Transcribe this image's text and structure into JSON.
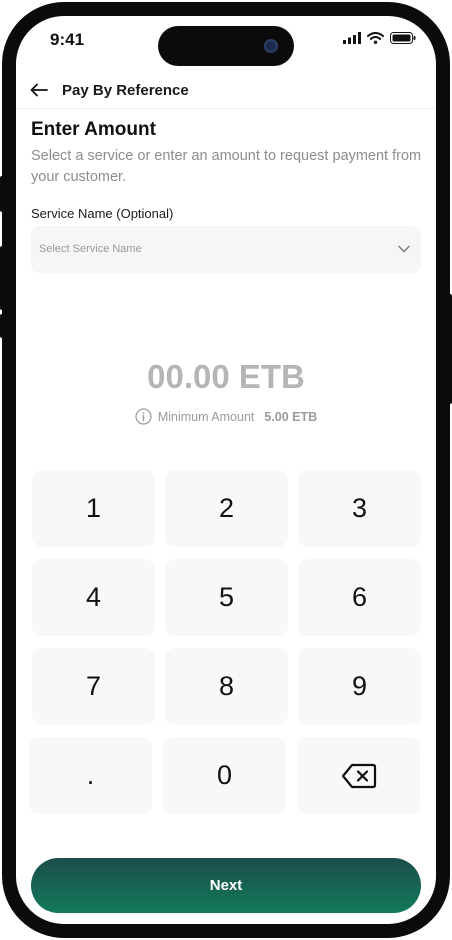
{
  "status_bar": {
    "time": "9:41"
  },
  "nav": {
    "title": "Pay By Reference"
  },
  "content": {
    "title": "Enter Amount",
    "subtitle": "Select a service or enter an amount to request payment from your customer."
  },
  "service_field": {
    "label": "Service Name (Optional)",
    "placeholder": "Select Service Name"
  },
  "amount": {
    "value": "00.00 ETB",
    "minimum_label": "Minimum Amount",
    "minimum_value": "5.00 ETB"
  },
  "keypad": {
    "keys": [
      "1",
      "2",
      "3",
      "4",
      "5",
      "6",
      "7",
      "8",
      "9",
      ".",
      "0"
    ],
    "backspace_icon": "backspace-icon"
  },
  "actions": {
    "next_label": "Next"
  },
  "colors": {
    "accent_start": "#1b4d4a",
    "accent_end": "#127a5a",
    "amount_placeholder": "#b5b5b5"
  }
}
